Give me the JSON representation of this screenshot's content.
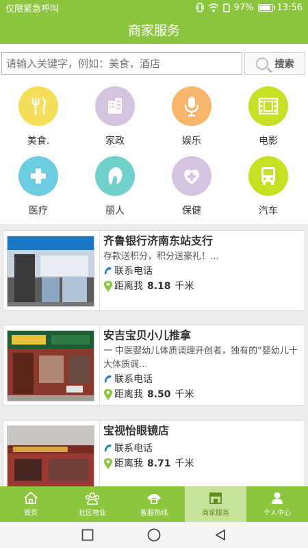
{
  "status_bar": {
    "carrier": "仅限紧急呼叫",
    "battery": "97%",
    "battery_level": 0.97,
    "time": "13:56"
  },
  "header": {
    "title": "商家服务"
  },
  "search": {
    "placeholder": "请输入关键字，例如：美食，酒店",
    "button_label": "搜索"
  },
  "categories": [
    {
      "label": "美食.",
      "icon": "utensils-icon",
      "color": "#f5de5a"
    },
    {
      "label": "家政",
      "icon": "building-icon",
      "color": "#d5c4e0"
    },
    {
      "label": "娱乐",
      "icon": "microphone-icon",
      "color": "#f7b66b"
    },
    {
      "label": "电影",
      "icon": "film-icon",
      "color": "#c8e024"
    },
    {
      "label": "医疗",
      "icon": "medical-cross-icon",
      "color": "#6dcde0"
    },
    {
      "label": "丽人",
      "icon": "woman-face-icon",
      "color": "#6fd0cc"
    },
    {
      "label": "保健",
      "icon": "health-care-icon",
      "color": "#d5c4e0"
    },
    {
      "label": "汽车",
      "icon": "bus-icon",
      "color": "#c8e024"
    }
  ],
  "businesses": [
    {
      "name": "齐鲁银行济南东站支行",
      "description": "存款送积分，积分送豪礼！...",
      "contact_label": "联系电话",
      "distance_label": "距离我",
      "distance_value": "8.18",
      "distance_unit": "千米"
    },
    {
      "name": "安吉宝贝小儿推拿",
      "description": "一 中医婴幼儿体质调理开创者，独有的“婴幼儿十大体质调...",
      "contact_label": "联系电话",
      "distance_label": "距离我",
      "distance_value": "8.50",
      "distance_unit": "千米"
    },
    {
      "name": "宝视怡眼镜店",
      "description": "",
      "contact_label": "联系电话",
      "distance_label": "距离我",
      "distance_value": "8.71",
      "distance_unit": "千米"
    }
  ],
  "tabs": [
    {
      "label": "首页",
      "icon": "home-icon"
    },
    {
      "label": "社区物业",
      "icon": "community-icon"
    },
    {
      "label": "客服热线",
      "icon": "hotline-icon"
    },
    {
      "label": "商家服务",
      "icon": "store-icon",
      "active": true
    },
    {
      "label": "个人中心",
      "icon": "person-icon"
    }
  ],
  "colors": {
    "brand": "#8cc63f",
    "active_tab": "#c7e39a"
  }
}
